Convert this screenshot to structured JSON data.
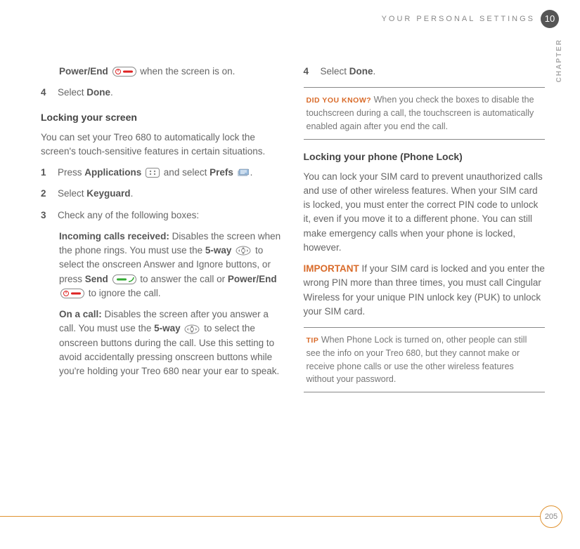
{
  "header": {
    "section": "YOUR PERSONAL SETTINGS",
    "chapter_num": "10",
    "chapter_label": "CHAPTER"
  },
  "left": {
    "power_end_prefix": "Power/End",
    "power_end_suffix": " when the screen is on.",
    "step4_num": "4",
    "step4_a": "Select ",
    "step4_b": "Done",
    "step4_c": ".",
    "heading1": "Locking your screen",
    "intro1": "You can set your Treo 680 to automatically lock the screen's touch-sensitive features in certain situations.",
    "s1_num": "1",
    "s1_a": "Press ",
    "s1_b": "Applications",
    "s1_c": " and select ",
    "s1_d": "Prefs",
    "s1_e": ".",
    "s2_num": "2",
    "s2_a": "Select ",
    "s2_b": "Keyguard",
    "s2_c": ".",
    "s3_num": "3",
    "s3_text": "Check any of the following boxes:",
    "inc_a": "Incoming calls received:",
    "inc_b": " Disables the screen when the phone rings. You must use the ",
    "inc_c": "5-way",
    "inc_d": " to select the onscreen Answer and Ignore buttons, or press ",
    "inc_e": "Send",
    "inc_f": " to answer the call or ",
    "inc_g": "Power/End",
    "inc_h": " to ignore the call.",
    "on_a": "On a call:",
    "on_b": " Disables the screen after you answer a call. You must use the ",
    "on_c": "5-way",
    "on_d": " to select the onscreen buttons during the call. Use this setting to avoid accidentally pressing onscreen buttons while you're holding your Treo 680 near your ear to speak."
  },
  "right": {
    "step4_num": "4",
    "step4_a": "Select ",
    "step4_b": "Done",
    "step4_c": ".",
    "dyk_label": "DID YOU KNOW?",
    "dyk_text": " When you check the boxes to disable the touchscreen during a call, the touchscreen is automatically enabled again after you end the call.",
    "heading2": "Locking your phone (Phone Lock)",
    "para2": "You can lock your SIM card to prevent unauthorized calls and use of other wireless features. When your SIM card is locked, you must enter the correct PIN code to unlock it, even if you move it to a different phone. You can still make emergency calls when your phone is locked, however.",
    "imp_label": "IMPORTANT",
    "imp_text": " If your SIM card is locked and you enter the wrong PIN more than three times, you must call Cingular Wireless for your unique PIN unlock key (PUK) to unlock your SIM card.",
    "tip_label": "TIP",
    "tip_text": " When Phone Lock is turned on, other people can still see the info on your Treo 680, but they cannot make or receive phone calls or use the other wireless features without your password."
  },
  "footer": {
    "page_num": "205"
  }
}
